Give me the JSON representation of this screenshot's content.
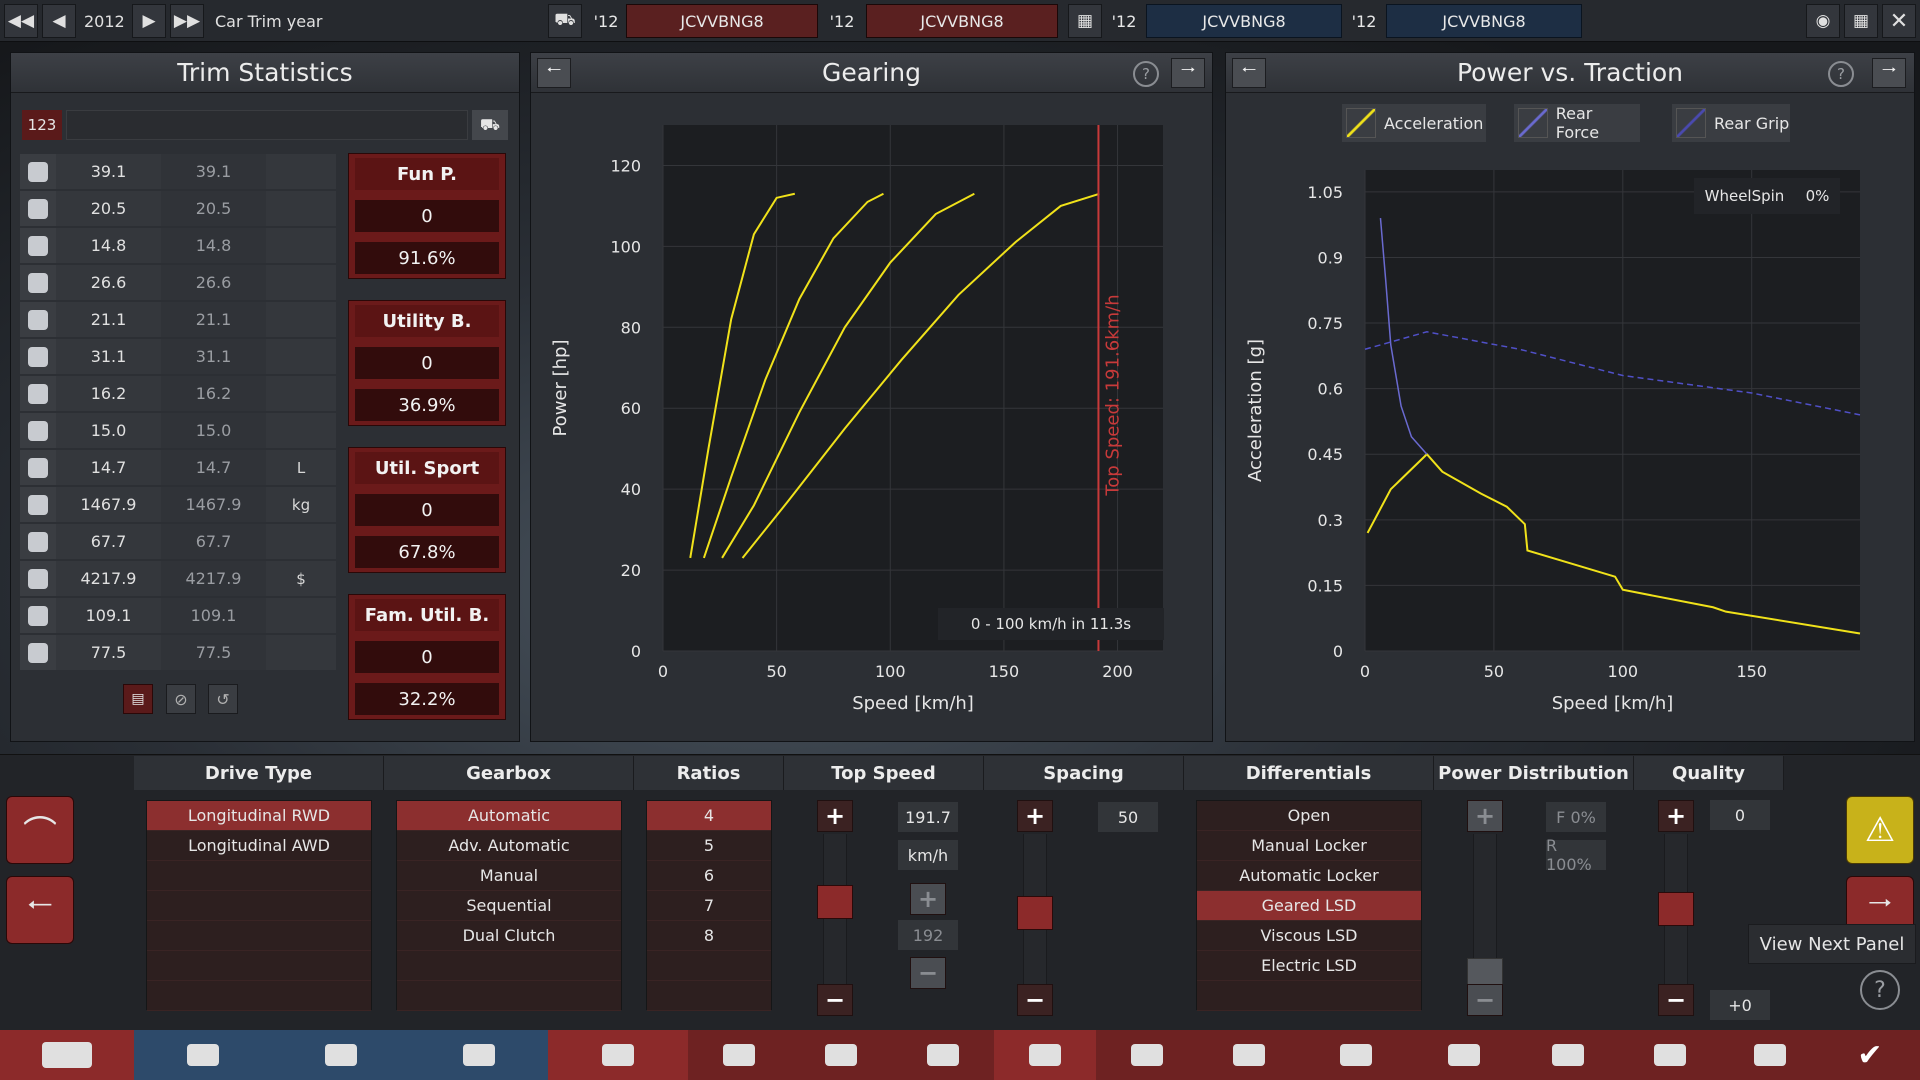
{
  "topbar": {
    "year": "2012",
    "label": "Car Trim year",
    "slots": [
      {
        "year": "'12",
        "name": "JCVVBNG8"
      },
      {
        "year": "'12",
        "name": "JCVVBNG8"
      },
      {
        "year": "'12",
        "name": "JCVVBNG8"
      },
      {
        "year": "'12",
        "name": "JCVVBNG8"
      }
    ]
  },
  "trim_stats": {
    "title": "Trim Statistics",
    "field_value": "123",
    "rows": [
      {
        "icon": "steering-wheel-icon",
        "v1": "39.1",
        "v2": "39.1",
        "unit": ""
      },
      {
        "icon": "race-flag-icon",
        "v1": "20.5",
        "v2": "20.5",
        "unit": ""
      },
      {
        "icon": "seat-icon",
        "v1": "14.8",
        "v2": "14.8",
        "unit": ""
      },
      {
        "icon": "diamond-icon",
        "v1": "26.6",
        "v2": "26.6",
        "unit": ""
      },
      {
        "icon": "safety-icon",
        "v1": "21.1",
        "v2": "21.1",
        "unit": ""
      },
      {
        "icon": "passengers-icon",
        "v1": "31.1",
        "v2": "31.1",
        "unit": ""
      },
      {
        "icon": "cargo-car-icon",
        "v1": "16.2",
        "v2": "16.2",
        "unit": ""
      },
      {
        "icon": "offroad-car-icon",
        "v1": "15.0",
        "v2": "15.0",
        "unit": ""
      },
      {
        "icon": "fuel-icon",
        "v1": "14.7",
        "v2": "14.7",
        "unit": "L"
      },
      {
        "icon": "weight-icon",
        "v1": "1467.9",
        "v2": "1467.9",
        "unit": "kg"
      },
      {
        "icon": "emissions-icon",
        "v1": "67.7",
        "v2": "67.7",
        "unit": ""
      },
      {
        "icon": "cost-icon",
        "v1": "4217.9",
        "v2": "4217.9",
        "unit": "$"
      },
      {
        "icon": "service-icon",
        "v1": "109.1",
        "v2": "109.1",
        "unit": ""
      },
      {
        "icon": "reliability-icon",
        "v1": "77.5",
        "v2": "77.5",
        "unit": ""
      }
    ],
    "ratings": [
      {
        "name": "Fun P.",
        "value": "0",
        "pct": "91.6%"
      },
      {
        "name": "Utility B.",
        "value": "0",
        "pct": "36.9%"
      },
      {
        "name": "Util. Sport",
        "value": "0",
        "pct": "67.8%"
      },
      {
        "name": "Fam. Util. B.",
        "value": "0",
        "pct": "32.2%"
      }
    ]
  },
  "gearing": {
    "title": "Gearing",
    "accel_note": "0 - 100 km/h in 11.3s",
    "top_speed_label": "Top Speed: 191.6km/h"
  },
  "traction": {
    "title": "Power vs. Traction",
    "wheelspin_label": "WheelSpin",
    "wheelspin_value": "0%",
    "legend": [
      "Acceleration",
      "Rear Force",
      "Rear Grip"
    ]
  },
  "chart_data": [
    {
      "type": "line",
      "xlabel": "Speed [km/h]",
      "ylabel": "Power [hp]",
      "xlim": [
        0,
        220
      ],
      "ylim": [
        0,
        130
      ],
      "xticks": [
        0,
        50,
        100,
        150,
        200
      ],
      "yticks": [
        0,
        20,
        40,
        60,
        80,
        100,
        120
      ],
      "grid": true,
      "series": [
        {
          "x": [
            12,
            20,
            30,
            40,
            50,
            58
          ],
          "values": [
            23,
            50,
            82,
            103,
            112,
            113
          ]
        },
        {
          "x": [
            18,
            30,
            45,
            60,
            75,
            90,
            97
          ],
          "values": [
            23,
            43,
            67,
            87,
            102,
            111,
            113
          ]
        },
        {
          "x": [
            26,
            40,
            60,
            80,
            100,
            120,
            137
          ],
          "values": [
            23,
            36,
            59,
            80,
            96,
            108,
            113
          ]
        },
        {
          "x": [
            35,
            55,
            80,
            105,
            130,
            155,
            175,
            192
          ],
          "values": [
            23,
            37,
            55,
            72,
            88,
            101,
            110,
            113
          ]
        }
      ],
      "top_speed_marker": 191.6
    },
    {
      "type": "line",
      "xlabel": "Speed [km/h]",
      "ylabel": "Acceleration [g]",
      "xlim": [
        0,
        192
      ],
      "ylim": [
        0,
        1.1
      ],
      "xticks": [
        0,
        50,
        100,
        150
      ],
      "yticks": [
        "0",
        "0.15",
        "0.3",
        "0.45",
        "0.6",
        "0.75",
        "0.9",
        "1.05"
      ],
      "grid": true,
      "series": [
        {
          "name": "Acceleration",
          "x": [
            1,
            10,
            24,
            30,
            45,
            55,
            62,
            63,
            80,
            97,
            100,
            135,
            140,
            192
          ],
          "values": [
            0.27,
            0.37,
            0.45,
            0.41,
            0.36,
            0.33,
            0.29,
            0.23,
            0.2,
            0.17,
            0.14,
            0.1,
            0.09,
            0.04
          ]
        },
        {
          "name": "Rear Force",
          "x": [
            6,
            8,
            10,
            14,
            18,
            24
          ],
          "values": [
            0.99,
            0.85,
            0.7,
            0.56,
            0.49,
            0.45
          ]
        },
        {
          "name": "Rear Grip",
          "x": [
            0,
            24,
            60,
            100,
            150,
            192
          ],
          "values": [
            0.69,
            0.73,
            0.69,
            0.63,
            0.59,
            0.54
          ]
        }
      ]
    }
  ],
  "bottom": {
    "drive_type": {
      "header": "Drive Type",
      "items": [
        "Longitudinal RWD",
        "Longitudinal AWD"
      ]
    },
    "gearbox": {
      "header": "Gearbox",
      "items": [
        "Automatic",
        "Adv. Automatic",
        "Manual",
        "Sequential",
        "Dual Clutch"
      ]
    },
    "ratios": {
      "header": "Ratios",
      "items": [
        "4",
        "5",
        "6",
        "7",
        "8"
      ]
    },
    "top_speed": {
      "header": "Top Speed",
      "value": "191.7",
      "unit": "km/h",
      "target": "192",
      "level": 0.55
    },
    "spacing": {
      "header": "Spacing",
      "value": "50",
      "level": 0.5
    },
    "differentials": {
      "header": "Differentials",
      "items": [
        "Open",
        "Manual Locker",
        "Automatic Locker",
        "Geared LSD",
        "Viscous LSD",
        "Electric LSD"
      ]
    },
    "power_dist": {
      "header": "Power Distribution",
      "front": "F 0%",
      "rear": "R 100%",
      "level": 0.0
    },
    "quality": {
      "header": "Quality",
      "value": "0",
      "delta": "+0",
      "level": 0.5
    },
    "tooltip": "View Next Panel"
  },
  "colors": {
    "accent_red": "#8c2f2f",
    "accel_line": "#f0e21a",
    "blue_line": "#6a6ad0",
    "marker": "#c83a3a"
  }
}
